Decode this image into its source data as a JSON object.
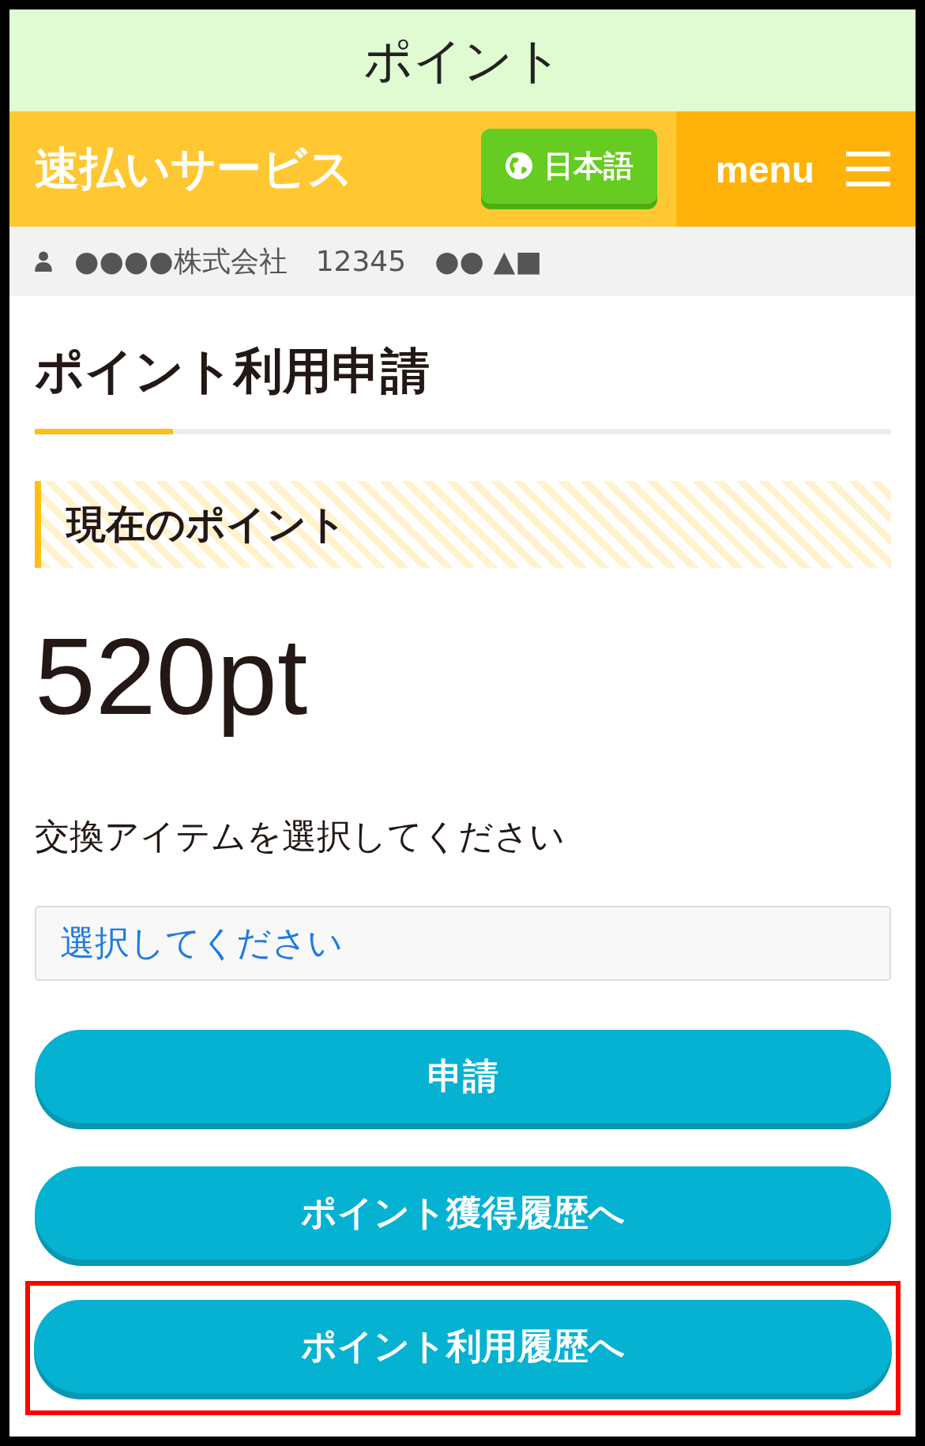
{
  "top_bar": {
    "title": "ポイント"
  },
  "header": {
    "brand": "速払いサービス",
    "language_button": "日本語",
    "menu_label": "menu"
  },
  "user_bar": {
    "text": "●●●●株式会社　12345　●● ▲■"
  },
  "page": {
    "heading": "ポイント利用申請",
    "section_title": "現在のポイント",
    "points": "520pt",
    "instruction": "交換アイテムを選択してください",
    "select": {
      "placeholder": "選択してください"
    }
  },
  "buttons": [
    {
      "label": "申請",
      "highlighted": false
    },
    {
      "label": "ポイント獲得履歴へ",
      "highlighted": false
    },
    {
      "label": "ポイント利用履歴へ",
      "highlighted": true
    }
  ]
}
